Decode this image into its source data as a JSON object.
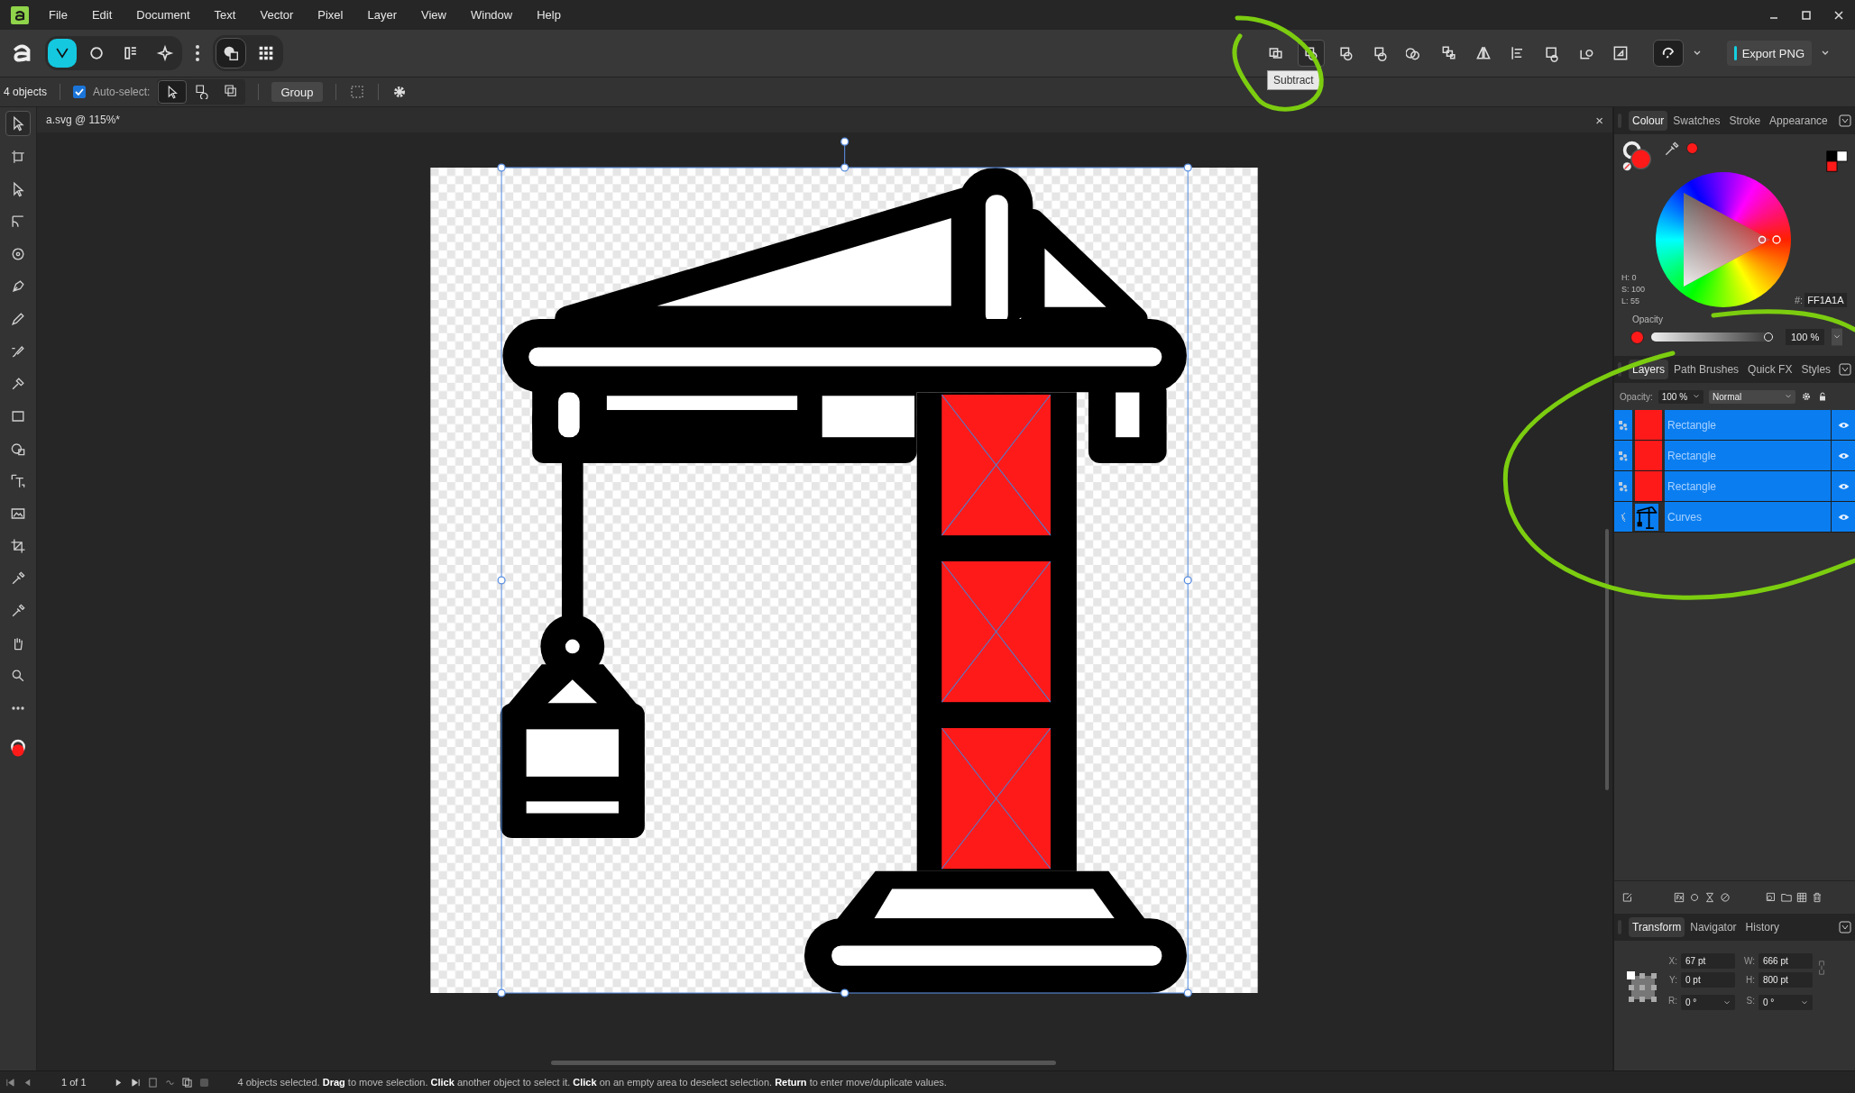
{
  "menu": [
    "File",
    "Edit",
    "Document",
    "Text",
    "Vector",
    "Pixel",
    "Layer",
    "View",
    "Window",
    "Help"
  ],
  "personas": [
    {
      "selected": true
    },
    {
      "selected": false
    },
    {
      "selected": false
    },
    {
      "selected": false
    }
  ],
  "context_bar": {
    "selection_count": "4 objects",
    "auto_select": {
      "label": "Auto-select:",
      "checked": true
    },
    "group_button": "Group"
  },
  "tooltip": "Subtract",
  "export_button": "Export PNG",
  "document_tab": {
    "title": "a.svg @ 115%*",
    "close": "×"
  },
  "colour_panel": {
    "tabs": [
      {
        "label": "Colour",
        "selected": true
      },
      {
        "label": "Swatches",
        "selected": false
      },
      {
        "label": "Stroke",
        "selected": false
      },
      {
        "label": "Appearance",
        "selected": false
      }
    ],
    "hsl": [
      "H: 0",
      "S: 100",
      "L: 55"
    ],
    "hex_label": "#:",
    "hex": "FF1A1A",
    "color": "#ff1a1a",
    "opacity_label": "Opacity",
    "opacity": "100 %",
    "level": 1
  },
  "layers_panel": {
    "tabs": [
      {
        "label": "Layers",
        "selected": true
      },
      {
        "label": "Path Brushes",
        "selected": false
      },
      {
        "label": "Quick FX",
        "selected": false
      },
      {
        "label": "Styles",
        "selected": false
      }
    ],
    "opacity_label": "Opacity:",
    "opacity": "100 %",
    "blend_mode": "Normal",
    "layers": [
      {
        "name": "Rectangle",
        "kind": "rectangle",
        "selected": true,
        "visible": true
      },
      {
        "name": "Rectangle",
        "kind": "rectangle",
        "selected": true,
        "visible": true
      },
      {
        "name": "Rectangle",
        "kind": "rectangle",
        "selected": true,
        "visible": true
      },
      {
        "name": "Curves",
        "kind": "curves",
        "selected": true,
        "visible": true
      }
    ]
  },
  "transform_panel": {
    "tabs": [
      {
        "label": "Transform",
        "selected": true
      },
      {
        "label": "Navigator",
        "selected": false
      },
      {
        "label": "History",
        "selected": false
      }
    ],
    "fields": [
      {
        "label": "X:",
        "value": "67 pt",
        "kind": "number"
      },
      {
        "label": "W:",
        "value": "666 pt",
        "kind": "number"
      },
      {
        "label": "Y:",
        "value": "0 pt",
        "kind": "number"
      },
      {
        "label": "H:",
        "value": "800 pt",
        "kind": "number"
      },
      {
        "label": "R:",
        "value": "0 °",
        "kind": "dropdown"
      },
      {
        "label": "S:",
        "value": "0 °",
        "kind": "dropdown"
      }
    ]
  },
  "status_bar": {
    "page": "1 of 1",
    "message": "4 objects selected. **Drag** to move selection. **Click** another object to select it. **Click** on an empty area to deselect selection. **Return** to enter move/duplicate values."
  }
}
